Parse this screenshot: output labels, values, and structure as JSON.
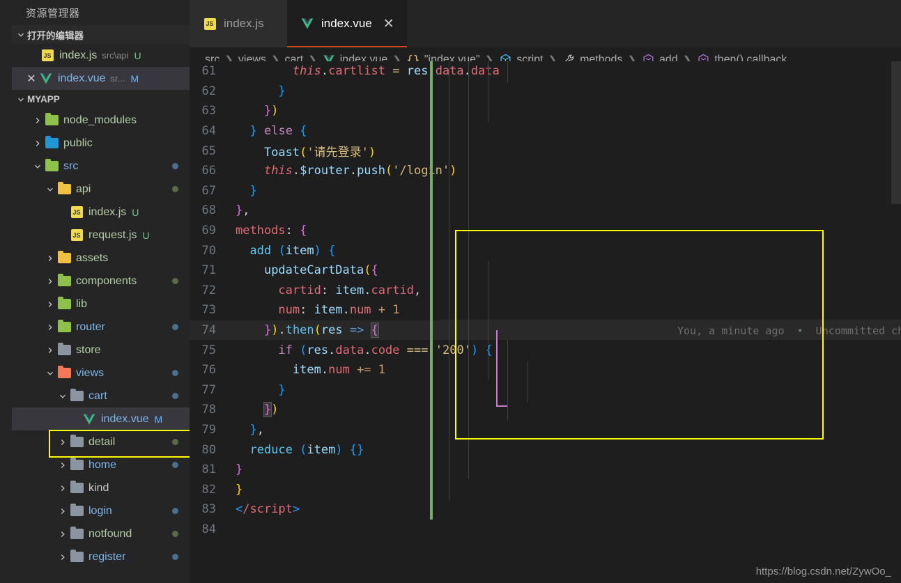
{
  "window": {
    "theme_bg": "#1e1e1e",
    "sidebar_bg": "#252526",
    "accent": "#cc4a21",
    "highlight_box_color": "#ffff00"
  },
  "sidebar": {
    "title": "资源管理器",
    "open_editors": {
      "label": "打开的编辑器",
      "items": [
        {
          "icon": "js-file-icon",
          "name": "index.js",
          "sub": "src\\api",
          "badge": "U",
          "badge_kind": "U",
          "selected": false,
          "has_close": false
        },
        {
          "icon": "vue-file-icon",
          "name": "index.vue",
          "sub": "sr...",
          "badge": "M",
          "badge_kind": "M",
          "selected": true,
          "has_close": true
        }
      ]
    },
    "project": {
      "label": "MYAPP",
      "tree": [
        {
          "name": "node_modules",
          "kind": "folder",
          "folder_color": "f-green",
          "depth": 1,
          "expanded": false,
          "arrow": "right",
          "dot": "",
          "badge": "",
          "name_color": "name-green"
        },
        {
          "name": "public",
          "kind": "folder",
          "folder_color": "f-blue",
          "depth": 1,
          "expanded": false,
          "arrow": "right",
          "dot": "",
          "badge": "",
          "name_color": "name-green"
        },
        {
          "name": "src",
          "kind": "folder",
          "folder_color": "f-green",
          "depth": 1,
          "expanded": true,
          "arrow": "down",
          "dot": "blue",
          "badge": "",
          "name_color": "name-blue"
        },
        {
          "name": "api",
          "kind": "folder",
          "folder_color": "f-yellow",
          "depth": 2,
          "expanded": true,
          "arrow": "down",
          "dot": "green",
          "badge": "",
          "name_color": "name-green"
        },
        {
          "name": "index.js",
          "kind": "js",
          "folder_color": "",
          "depth": 3,
          "expanded": false,
          "arrow": "none",
          "dot": "",
          "badge": "U",
          "name_color": "name-green"
        },
        {
          "name": "request.js",
          "kind": "js",
          "folder_color": "",
          "depth": 3,
          "expanded": false,
          "arrow": "none",
          "dot": "",
          "badge": "U",
          "name_color": "name-green"
        },
        {
          "name": "assets",
          "kind": "folder",
          "folder_color": "f-yellow",
          "depth": 2,
          "expanded": false,
          "arrow": "right",
          "dot": "",
          "badge": "",
          "name_color": "name-green"
        },
        {
          "name": "components",
          "kind": "folder",
          "folder_color": "f-green",
          "depth": 2,
          "expanded": false,
          "arrow": "right",
          "dot": "green",
          "badge": "",
          "name_color": "name-green"
        },
        {
          "name": "lib",
          "kind": "folder",
          "folder_color": "f-green",
          "depth": 2,
          "expanded": false,
          "arrow": "right",
          "dot": "",
          "badge": "",
          "name_color": "name-green"
        },
        {
          "name": "router",
          "kind": "folder",
          "folder_color": "f-green",
          "depth": 2,
          "expanded": false,
          "arrow": "right",
          "dot": "blue",
          "badge": "",
          "name_color": "name-blue"
        },
        {
          "name": "store",
          "kind": "folder",
          "folder_color": "f-gray",
          "depth": 2,
          "expanded": false,
          "arrow": "right",
          "dot": "",
          "badge": "",
          "name_color": "name-green"
        },
        {
          "name": "views",
          "kind": "folder",
          "folder_color": "f-red",
          "depth": 2,
          "expanded": true,
          "arrow": "down",
          "dot": "blue",
          "badge": "",
          "name_color": "name-blue"
        },
        {
          "name": "cart",
          "kind": "folder",
          "folder_color": "f-gray",
          "depth": 3,
          "expanded": true,
          "arrow": "down",
          "dot": "blue",
          "badge": "",
          "name_color": "name-blue"
        },
        {
          "name": "index.vue",
          "kind": "vue",
          "folder_color": "",
          "depth": 4,
          "expanded": false,
          "arrow": "none",
          "dot": "",
          "badge": "M",
          "name_color": "name-blue",
          "selected": true,
          "highlighted": true
        },
        {
          "name": "detail",
          "kind": "folder",
          "folder_color": "f-gray",
          "depth": 3,
          "expanded": false,
          "arrow": "right",
          "dot": "green",
          "badge": "",
          "name_color": "name-green"
        },
        {
          "name": "home",
          "kind": "folder",
          "folder_color": "f-gray",
          "depth": 3,
          "expanded": false,
          "arrow": "right",
          "dot": "blue",
          "badge": "",
          "name_color": "name-blue"
        },
        {
          "name": "kind",
          "kind": "folder",
          "folder_color": "f-gray",
          "depth": 3,
          "expanded": false,
          "arrow": "right",
          "dot": "",
          "badge": "",
          "name_color": "name-white"
        },
        {
          "name": "login",
          "kind": "folder",
          "folder_color": "f-gray",
          "depth": 3,
          "expanded": false,
          "arrow": "right",
          "dot": "blue",
          "badge": "",
          "name_color": "name-blue"
        },
        {
          "name": "notfound",
          "kind": "folder",
          "folder_color": "f-gray",
          "depth": 3,
          "expanded": false,
          "arrow": "right",
          "dot": "green",
          "badge": "",
          "name_color": "name-green"
        },
        {
          "name": "register",
          "kind": "folder",
          "folder_color": "f-gray",
          "depth": 3,
          "expanded": false,
          "arrow": "right",
          "dot": "blue",
          "badge": "",
          "name_color": "name-blue"
        }
      ]
    }
  },
  "tabs": [
    {
      "icon": "js-file-icon",
      "label": "index.js",
      "active": false,
      "closable": false
    },
    {
      "icon": "vue-file-icon",
      "label": "index.vue",
      "active": true,
      "closable": true,
      "close_glyph": "✕"
    }
  ],
  "breadcrumb": [
    {
      "icon": "",
      "label": "src"
    },
    {
      "icon": "",
      "label": "views"
    },
    {
      "icon": "",
      "label": "cart"
    },
    {
      "icon": "vue-file-icon",
      "label": "index.vue"
    },
    {
      "icon": "json-braces-icon",
      "label": "\"index.vue\""
    },
    {
      "icon": "module-cube-icon",
      "label": "script"
    },
    {
      "icon": "wrench-icon",
      "label": "methods"
    },
    {
      "icon": "symbol-method-icon",
      "label": "add"
    },
    {
      "icon": "symbol-method-icon",
      "label": "then() callback"
    }
  ],
  "editor": {
    "first_line": 61,
    "current_line": 74,
    "blame": "You, a minute ago  •  Uncommitted changes",
    "lines": [
      {
        "n": 61,
        "tokens": [
          {
            "t": "        ",
            "c": "t-plain"
          },
          {
            "t": "this",
            "c": "t-this"
          },
          {
            "t": ".",
            "c": "t-plain"
          },
          {
            "t": "cartlist",
            "c": "t-prop"
          },
          {
            "t": " ",
            "c": "t-plain"
          },
          {
            "t": "=",
            "c": "t-str2"
          },
          {
            "t": " ",
            "c": "t-plain"
          },
          {
            "t": "res",
            "c": "t-var"
          },
          {
            "t": ".",
            "c": "t-plain"
          },
          {
            "t": "data",
            "c": "t-prop"
          },
          {
            "t": ".",
            "c": "t-plain"
          },
          {
            "t": "data",
            "c": "t-prop"
          }
        ]
      },
      {
        "n": 62,
        "tokens": [
          {
            "t": "      ",
            "c": "t-plain"
          },
          {
            "t": "}",
            "c": "t-b3"
          }
        ]
      },
      {
        "n": 63,
        "tokens": [
          {
            "t": "    ",
            "c": "t-plain"
          },
          {
            "t": "}",
            "c": "t-b2"
          },
          {
            "t": ")",
            "c": "t-b1"
          }
        ]
      },
      {
        "n": 64,
        "tokens": [
          {
            "t": "  ",
            "c": "t-plain"
          },
          {
            "t": "}",
            "c": "t-b3"
          },
          {
            "t": " ",
            "c": "t-plain"
          },
          {
            "t": "else",
            "c": "t-key"
          },
          {
            "t": " ",
            "c": "t-plain"
          },
          {
            "t": "{",
            "c": "t-b3"
          }
        ]
      },
      {
        "n": 65,
        "tokens": [
          {
            "t": "    ",
            "c": "t-plain"
          },
          {
            "t": "Toast",
            "c": "t-var"
          },
          {
            "t": "(",
            "c": "t-b1"
          },
          {
            "t": "'请先登录'",
            "c": "t-mstr"
          },
          {
            "t": ")",
            "c": "t-b1"
          }
        ]
      },
      {
        "n": 66,
        "tokens": [
          {
            "t": "    ",
            "c": "t-plain"
          },
          {
            "t": "this",
            "c": "t-this"
          },
          {
            "t": ".",
            "c": "t-plain"
          },
          {
            "t": "$router",
            "c": "t-var"
          },
          {
            "t": ".",
            "c": "t-plain"
          },
          {
            "t": "push",
            "c": "t-var"
          },
          {
            "t": "(",
            "c": "t-b1"
          },
          {
            "t": "'/login'",
            "c": "t-mstr"
          },
          {
            "t": ")",
            "c": "t-b1"
          }
        ]
      },
      {
        "n": 67,
        "tokens": [
          {
            "t": "  ",
            "c": "t-plain"
          },
          {
            "t": "}",
            "c": "t-b3"
          }
        ]
      },
      {
        "n": 68,
        "tokens": [
          {
            "t": "",
            "c": "t-plain"
          },
          {
            "t": "}",
            "c": "t-b2"
          },
          {
            "t": ",",
            "c": "t-plain"
          }
        ]
      },
      {
        "n": 69,
        "tokens": [
          {
            "t": "",
            "c": "t-plain"
          },
          {
            "t": "methods",
            "c": "t-prop"
          },
          {
            "t": ": ",
            "c": "t-plain"
          },
          {
            "t": "{",
            "c": "t-b2"
          }
        ]
      },
      {
        "n": 70,
        "tokens": [
          {
            "t": "  ",
            "c": "t-plain"
          },
          {
            "t": "add",
            "c": "t-fn"
          },
          {
            "t": " ",
            "c": "t-plain"
          },
          {
            "t": "(",
            "c": "t-b3"
          },
          {
            "t": "item",
            "c": "t-var"
          },
          {
            "t": ")",
            "c": "t-b3"
          },
          {
            "t": " ",
            "c": "t-plain"
          },
          {
            "t": "{",
            "c": "t-b3"
          }
        ]
      },
      {
        "n": 71,
        "tokens": [
          {
            "t": "    ",
            "c": "t-plain"
          },
          {
            "t": "updateCartData",
            "c": "t-var"
          },
          {
            "t": "(",
            "c": "t-b1"
          },
          {
            "t": "{",
            "c": "t-b2"
          }
        ]
      },
      {
        "n": 72,
        "tokens": [
          {
            "t": "      ",
            "c": "t-plain"
          },
          {
            "t": "cartid",
            "c": "t-prop"
          },
          {
            "t": ": ",
            "c": "t-plain"
          },
          {
            "t": "item",
            "c": "t-var"
          },
          {
            "t": ".",
            "c": "t-plain"
          },
          {
            "t": "cartid",
            "c": "t-prop"
          },
          {
            "t": ",",
            "c": "t-plain"
          }
        ]
      },
      {
        "n": 73,
        "tokens": [
          {
            "t": "      ",
            "c": "t-plain"
          },
          {
            "t": "num",
            "c": "t-prop"
          },
          {
            "t": ": ",
            "c": "t-plain"
          },
          {
            "t": "item",
            "c": "t-var"
          },
          {
            "t": ".",
            "c": "t-plain"
          },
          {
            "t": "num",
            "c": "t-prop"
          },
          {
            "t": " ",
            "c": "t-plain"
          },
          {
            "t": "+",
            "c": "t-num"
          },
          {
            "t": " ",
            "c": "t-plain"
          },
          {
            "t": "1",
            "c": "t-num"
          }
        ]
      },
      {
        "n": 74,
        "tokens": [
          {
            "t": "    ",
            "c": "t-plain"
          },
          {
            "t": "}",
            "c": "t-b2"
          },
          {
            "t": ")",
            "c": "t-b1"
          },
          {
            "t": ".",
            "c": "t-plain"
          },
          {
            "t": "then",
            "c": "t-fn"
          },
          {
            "t": "(",
            "c": "t-b1"
          },
          {
            "t": "res",
            "c": "t-var"
          },
          {
            "t": " ",
            "c": "t-plain"
          },
          {
            "t": "=>",
            "c": "t-ctrl"
          },
          {
            "t": " ",
            "c": "t-plain"
          },
          {
            "t": "{",
            "c": "t-b2",
            "m": true
          }
        ]
      },
      {
        "n": 75,
        "tokens": [
          {
            "t": "      ",
            "c": "t-plain"
          },
          {
            "t": "if",
            "c": "t-key"
          },
          {
            "t": " ",
            "c": "t-plain"
          },
          {
            "t": "(",
            "c": "t-b3"
          },
          {
            "t": "res",
            "c": "t-var"
          },
          {
            "t": ".",
            "c": "t-plain"
          },
          {
            "t": "data",
            "c": "t-prop"
          },
          {
            "t": ".",
            "c": "t-plain"
          },
          {
            "t": "code",
            "c": "t-prop"
          },
          {
            "t": " ",
            "c": "t-plain"
          },
          {
            "t": "===",
            "c": "t-str2"
          },
          {
            "t": " ",
            "c": "t-plain"
          },
          {
            "t": "'200'",
            "c": "t-mstr"
          },
          {
            "t": ")",
            "c": "t-b3"
          },
          {
            "t": " ",
            "c": "t-plain"
          },
          {
            "t": "{",
            "c": "t-b3"
          }
        ]
      },
      {
        "n": 76,
        "tokens": [
          {
            "t": "        ",
            "c": "t-plain"
          },
          {
            "t": "item",
            "c": "t-var"
          },
          {
            "t": ".",
            "c": "t-plain"
          },
          {
            "t": "num",
            "c": "t-prop"
          },
          {
            "t": " ",
            "c": "t-plain"
          },
          {
            "t": "+=",
            "c": "t-num"
          },
          {
            "t": " ",
            "c": "t-plain"
          },
          {
            "t": "1",
            "c": "t-num"
          }
        ]
      },
      {
        "n": 77,
        "tokens": [
          {
            "t": "      ",
            "c": "t-plain"
          },
          {
            "t": "}",
            "c": "t-b3"
          }
        ]
      },
      {
        "n": 78,
        "tokens": [
          {
            "t": "    ",
            "c": "t-plain"
          },
          {
            "t": "}",
            "c": "t-b2",
            "m": true
          },
          {
            "t": ")",
            "c": "t-b1"
          }
        ]
      },
      {
        "n": 79,
        "tokens": [
          {
            "t": "  ",
            "c": "t-plain"
          },
          {
            "t": "}",
            "c": "t-b3"
          },
          {
            "t": ",",
            "c": "t-plain"
          }
        ]
      },
      {
        "n": 80,
        "tokens": [
          {
            "t": "  ",
            "c": "t-plain"
          },
          {
            "t": "reduce",
            "c": "t-fn"
          },
          {
            "t": " ",
            "c": "t-plain"
          },
          {
            "t": "(",
            "c": "t-b3"
          },
          {
            "t": "item",
            "c": "t-var"
          },
          {
            "t": ")",
            "c": "t-b3"
          },
          {
            "t": " ",
            "c": "t-plain"
          },
          {
            "t": "{}",
            "c": "t-b3"
          }
        ]
      },
      {
        "n": 81,
        "tokens": [
          {
            "t": "",
            "c": "t-plain"
          },
          {
            "t": "}",
            "c": "t-b2"
          }
        ]
      },
      {
        "n": 82,
        "tokens": [
          {
            "t": "",
            "c": "t-plain"
          },
          {
            "t": "}",
            "c": "t-b1"
          }
        ]
      },
      {
        "n": 83,
        "tokens": [
          {
            "t": "",
            "c": "t-plain"
          },
          {
            "t": "<",
            "c": "t-b3"
          },
          {
            "t": "/script",
            "c": "t-tag"
          },
          {
            "t": ">",
            "c": "t-b3"
          }
        ]
      },
      {
        "n": 84,
        "tokens": [
          {
            "t": "",
            "c": "t-plain"
          }
        ]
      }
    ]
  },
  "watermark": "https://blog.csdn.net/ZywOo_"
}
